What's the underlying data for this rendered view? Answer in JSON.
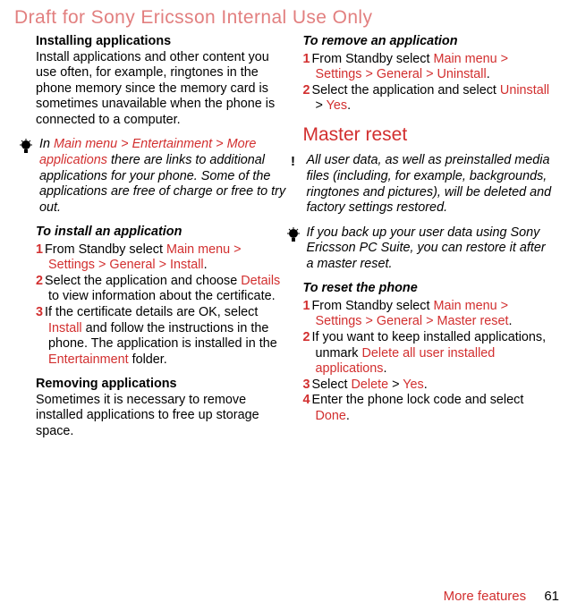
{
  "draft_notice": "Draft for Sony Ericsson Internal Use Only",
  "left": {
    "h1": "Installing applications",
    "intro": "Install applications and other content you use often, for example, ringtones in the phone memory since the memory card is sometimes unavailable when the phone is connected to a computer.",
    "tip1_prefix": "In ",
    "tip1_red": "Main menu > Entertainment > More applications",
    "tip1_rest": " there are links to additional applications for your phone. Some of the applications are free of charge or free to try out.",
    "h2": "To install an application",
    "s1_num": "1",
    "s1_a": "From Standby select ",
    "s1_red": "Main menu > Settings > General > Install",
    "s1_dot": ".",
    "s2_num": "2",
    "s2_a": "Select the application and choose ",
    "s2_red": "Details",
    "s2_b": " to view information about the certificate.",
    "s3_num": "3",
    "s3_a": "If the certificate details are OK, select ",
    "s3_red": "Install",
    "s3_b": " and follow the instructions in the phone. The application is installed in the ",
    "s3_red2": "Entertainment",
    "s3_c": " folder.",
    "h3": "Removing applications",
    "rempara": "Sometimes it is necessary to remove installed applications to free up storage space."
  },
  "right": {
    "h1": "To remove an application",
    "s1_num": "1",
    "s1_a": "From Standby select ",
    "s1_red": "Main menu > Settings > General > Uninstall",
    "s1_dot": ".",
    "s2_num": "2",
    "s2_a": "Select the application and select ",
    "s2_red": "Uninstall",
    "s2_gt": " > ",
    "s2_red2": "Yes",
    "s2_dot": ".",
    "h2": "Master reset",
    "warn_text": "All user data, as well as preinstalled media files (including, for example, backgrounds, ringtones and pictures), will be deleted and factory settings restored.",
    "tip_text": "If you back up your user data using Sony Ericsson PC Suite, you can restore it after a master reset.",
    "h3": "To reset the phone",
    "r1_num": "1",
    "r1_a": "From Standby select ",
    "r1_red": "Main menu > Settings > General > Master reset",
    "r1_dot": ".",
    "r2_num": "2",
    "r2_a": "If you want to keep installed applications, unmark ",
    "r2_red": "Delete all user installed applications",
    "r2_dot": ".",
    "r3_num": "3",
    "r3_a": "Select ",
    "r3_red": "Delete",
    "r3_gt": " > ",
    "r3_red2": "Yes",
    "r3_dot": ".",
    "r4_num": "4",
    "r4_a": "Enter the phone lock code and select ",
    "r4_red": "Done",
    "r4_dot": "."
  },
  "footer": {
    "section": "More features",
    "page": "61"
  }
}
